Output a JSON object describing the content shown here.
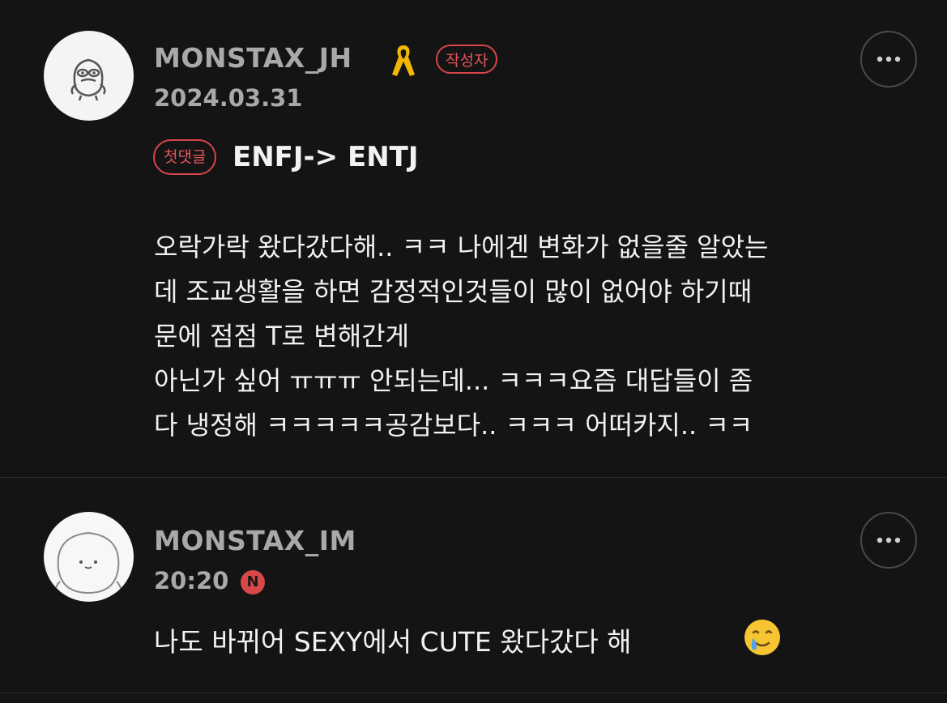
{
  "comments": [
    {
      "username": "MONSTAX_JH",
      "date": "2024.03.31",
      "author_badge": "작성자",
      "first_comment_badge": "첫댓글",
      "title": "ENFJ-> ENTJ",
      "body_lines": [
        "오락가락 왔다갔다해.. ㅋㅋ 나에겐 변화가 없을줄 알았는",
        "데 조교생활을 하면 감정적인것들이 많이 없어야 하기때",
        "문에 점점 T로 변해간게",
        "아닌가 싶어 ㅠㅠㅠ 안되는데... ㅋㅋㅋ요즘 대답들이 좀",
        "다 냉정해 ㅋㅋㅋㅋㅋ공감보다.. ㅋㅋㅋ 어떠카지.. ㅋㅋ"
      ],
      "avatar_icon": "creature-avatar-icon",
      "ribbon_icon": "yellow-ribbon-icon",
      "ribbon_color": "#f2b705"
    },
    {
      "username": "MONSTAX_IM",
      "time": "20:20",
      "new_badge": "N",
      "body": "나도 바뀌어 SEXY에서 CUTE 왔다갔다 해",
      "avatar_icon": "round-face-avatar-icon",
      "emoji_icon": "crying-smile-emoji-icon"
    }
  ],
  "colors": {
    "background": "#141414",
    "username": "#a9a9a9",
    "badge_red": "#d8454a",
    "text": "#f2f2f2"
  }
}
